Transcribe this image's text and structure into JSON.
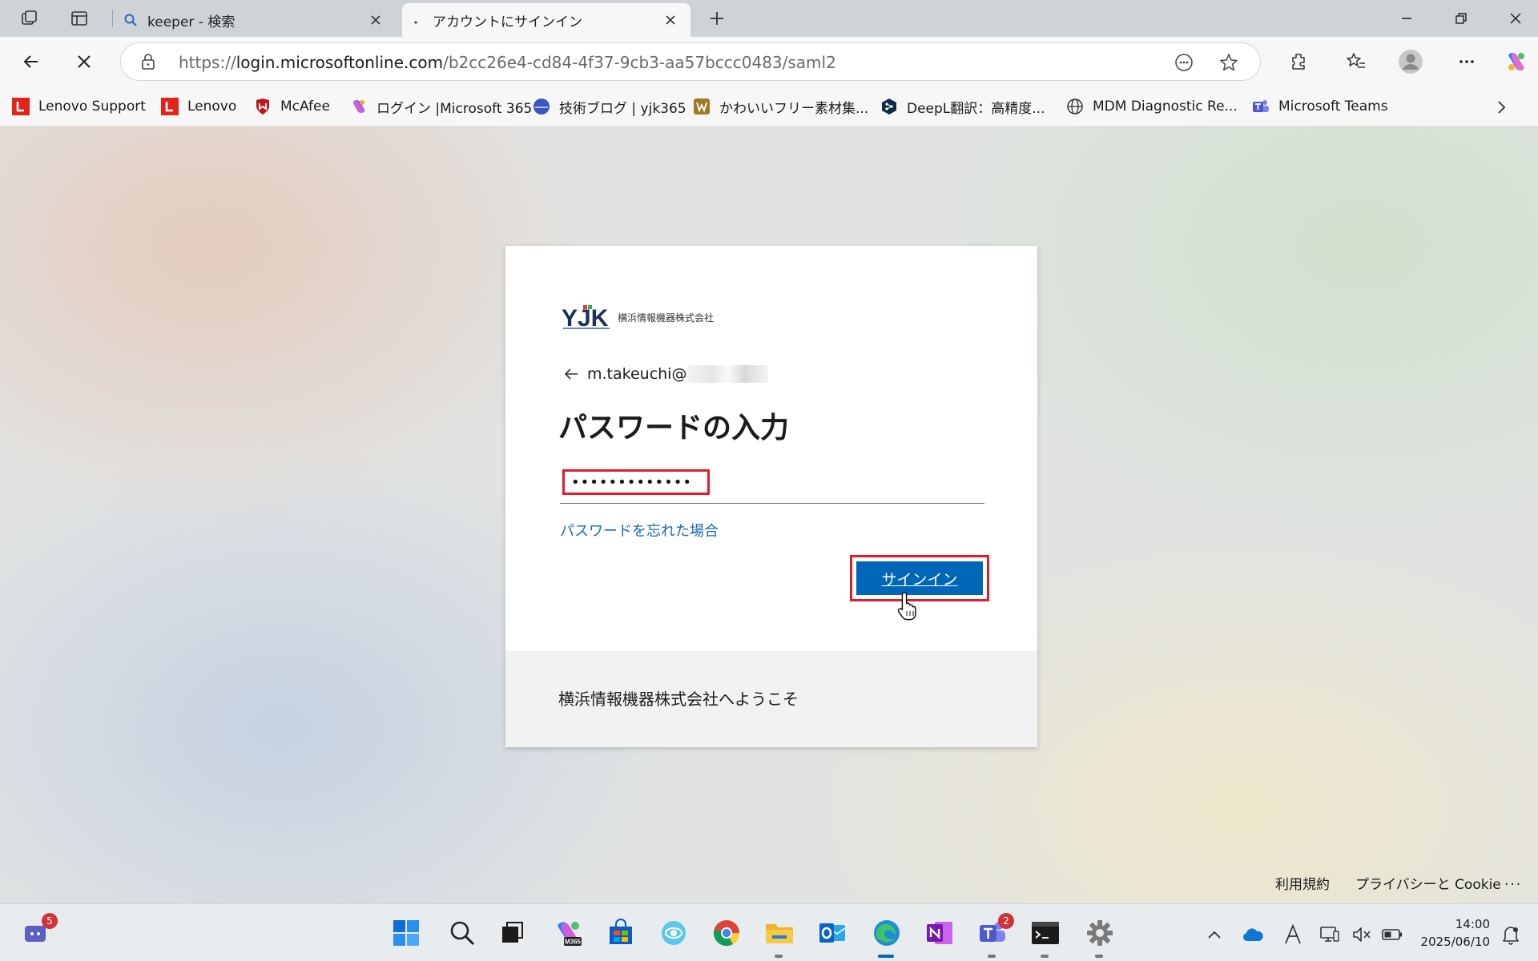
{
  "browser": {
    "tabs": [
      {
        "title": "keeper - 検索",
        "active": false,
        "favicon": "search-icon"
      },
      {
        "title": "アカウントにサインイン",
        "active": true,
        "favicon": "loading-icon"
      }
    ],
    "address": {
      "scheme": "https://",
      "host": "login.microsoftonline.com",
      "path": "/b2cc26e4-cd84-4f37-9cb3-aa57bccc0483/saml2"
    },
    "favorites": [
      {
        "label": "Lenovo Support",
        "icon": "lenovo-icon"
      },
      {
        "label": "Lenovo",
        "icon": "lenovo-icon"
      },
      {
        "label": "McAfee",
        "icon": "mcafee-icon"
      },
      {
        "label": "ログイン |Microsoft 365",
        "icon": "microsoft365-icon"
      },
      {
        "label": "技術ブログ | yjk365",
        "icon": "blog-icon"
      },
      {
        "label": "かわいいフリー素材集...",
        "icon": "irasutoya-icon"
      },
      {
        "label": "DeepL翻訳：高精度...",
        "icon": "deepl-icon"
      },
      {
        "label": "MDM Diagnostic Re...",
        "icon": "globe-icon"
      },
      {
        "label": "Microsoft Teams",
        "icon": "teams-icon"
      }
    ]
  },
  "signin": {
    "logo_mark": "YJK",
    "logo_text": "横浜情報機器株式会社",
    "identity": "m.takeuchi@",
    "heading": "パスワードの入力",
    "password_value": "•••••••••••••",
    "forgot_link": "パスワードを忘れた場合",
    "submit_label": "サインイン",
    "footer_text": "横浜情報機器株式会社へようこそ",
    "accent_color": "#0067b8",
    "highlight_color": "#e11d2b"
  },
  "legal": {
    "terms": "利用規約",
    "privacy": "プライバシーと Cookie",
    "more": "..."
  },
  "taskbar": {
    "notification_badge": "5",
    "teams_badge": "2",
    "copilot_label": "M365",
    "time": "14:00",
    "date": "2025/06/10"
  }
}
